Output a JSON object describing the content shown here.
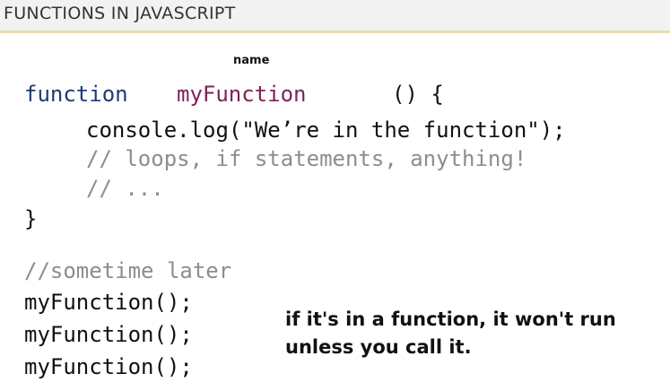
{
  "header": {
    "title": "FUNCTIONS IN JAVASCRIPT",
    "accent_color": "#e9ddb0"
  },
  "annotation": {
    "name_label": "name"
  },
  "code": {
    "keyword": "function",
    "function_name": "myFunction",
    "params_open": "() {",
    "body_line": "console.log(\"We’re in the function\");",
    "comment_1": "// loops, if statements, anything!",
    "comment_2": "// ...",
    "close_brace": "}",
    "later_comment": "//sometime later",
    "calls": [
      "myFunction();",
      "myFunction();",
      "myFunction();"
    ]
  },
  "note": {
    "line_1": "if it's in a function, it won't run",
    "line_2": "unless you call it."
  },
  "colors": {
    "keyword": "#1f3b73",
    "function_name": "#7d2356",
    "comment": "#8d8d8d"
  }
}
